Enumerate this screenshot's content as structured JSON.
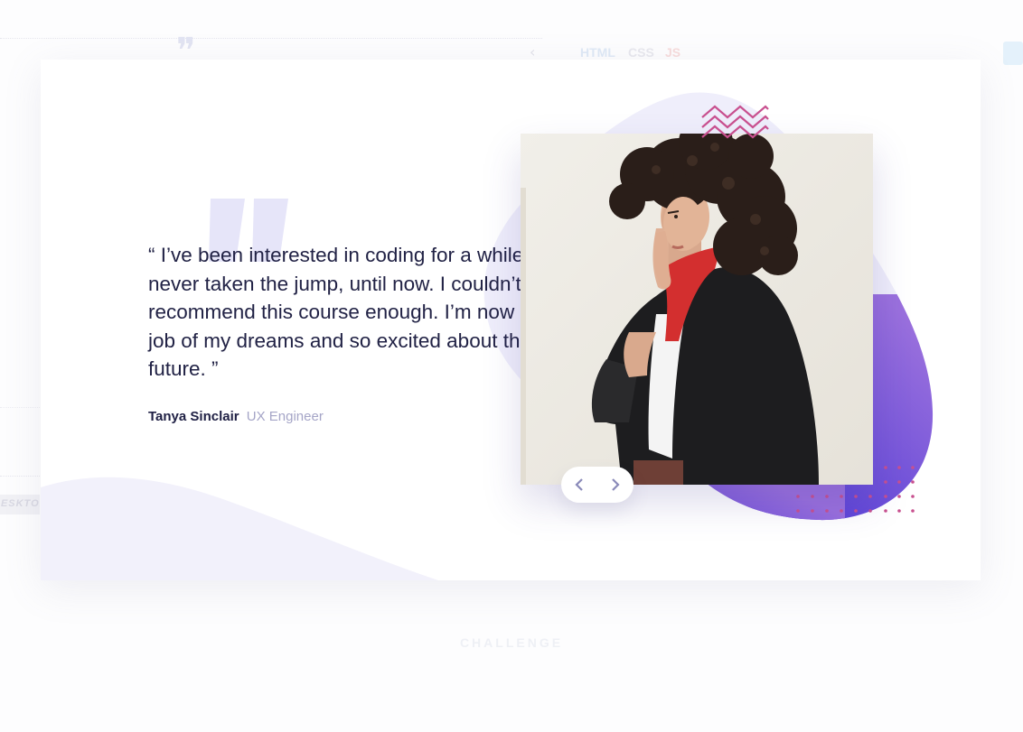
{
  "testimonial": {
    "quote": "“ I’ve been interested in coding for a while but never taken the jump, until now. I couldn’t recommend this course enough. I’m now in the job of my dreams and so excited about the future. ”",
    "author_name": "Tanya Sinclair",
    "author_role": "UX Engineer"
  },
  "background": {
    "tech_labels": [
      "HTML",
      "CSS",
      "JS"
    ],
    "desktop_label": "DESKTOP",
    "footer_label": "CHALLENGE"
  },
  "icons": {
    "prev": "chevron-left-icon",
    "next": "chevron-right-icon",
    "quote": "quote-mark-icon",
    "zigzag": "zigzag-decoration",
    "dots": "dot-grid-decoration"
  },
  "colors": {
    "text_dark": "#212245",
    "text_muted": "#a5a5c7",
    "accent_purple": "#5c46d3",
    "accent_pink": "#c8508f",
    "pale_lavender": "#f1f0fb",
    "quote_mark": "#e4e3f8"
  }
}
